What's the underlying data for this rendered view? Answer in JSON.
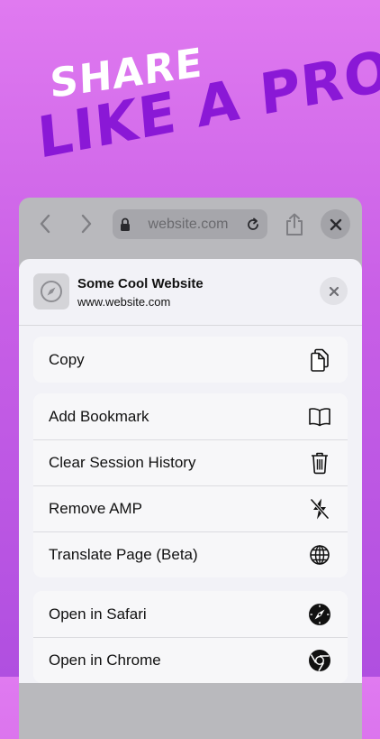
{
  "headline": {
    "line1": "SHARE",
    "line2": "LIKE A PRO"
  },
  "browser": {
    "url": "website.com",
    "icons": {
      "back": "chevron-left-icon",
      "forward": "chevron-right-icon",
      "lock": "lock-icon",
      "reload": "reload-icon",
      "share": "share-icon",
      "close": "close-icon"
    }
  },
  "share_sheet": {
    "site_title": "Some Cool Website",
    "site_url": "www.website.com",
    "site_icon": "compass-icon",
    "groups": [
      [
        {
          "label": "Copy",
          "icon": "copy-icon"
        }
      ],
      [
        {
          "label": "Add Bookmark",
          "icon": "book-icon"
        },
        {
          "label": "Clear Session History",
          "icon": "trash-icon"
        },
        {
          "label": "Remove AMP",
          "icon": "bolt-slash-icon"
        },
        {
          "label": "Translate Page (Beta)",
          "icon": "globe-icon"
        }
      ],
      [
        {
          "label": "Open in Safari",
          "icon": "safari-icon"
        },
        {
          "label": "Open in Chrome",
          "icon": "chrome-icon"
        }
      ]
    ]
  },
  "colors": {
    "background_top": "#e07af0",
    "background_bottom": "#b04fe0",
    "headline_white": "#ffffff",
    "headline_purple": "#8a18d6"
  }
}
